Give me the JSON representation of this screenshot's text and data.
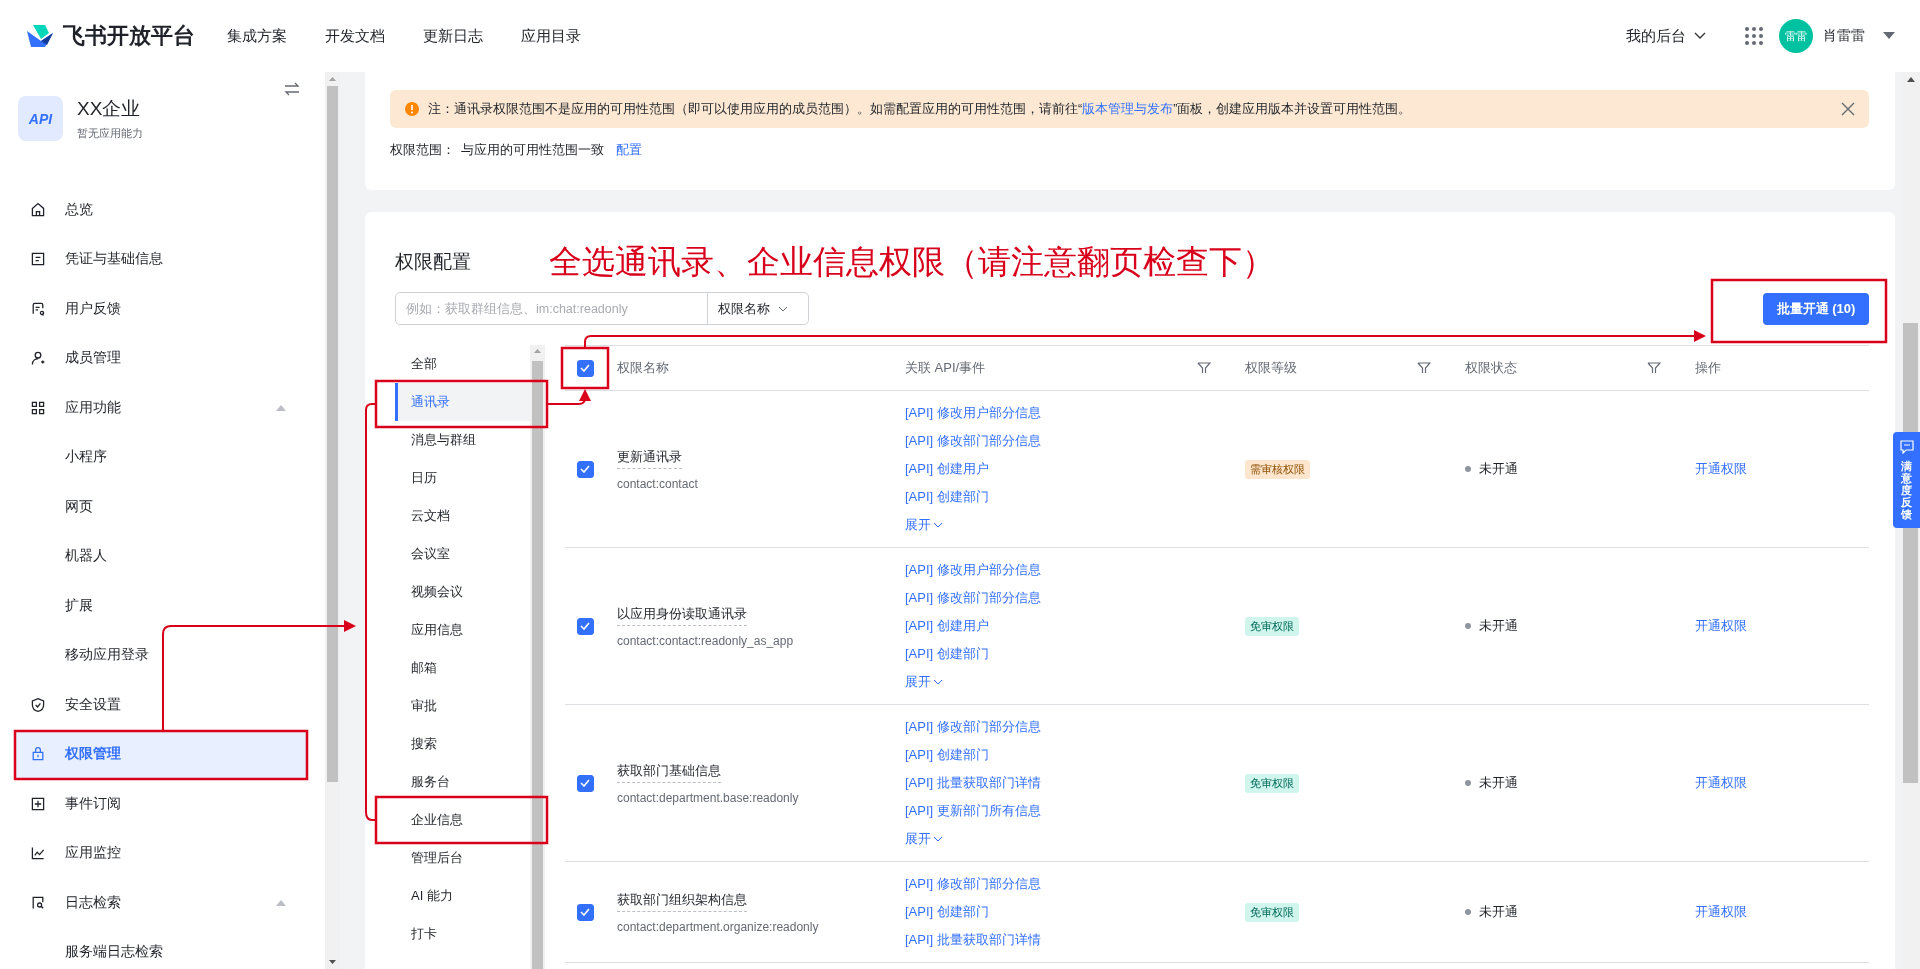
{
  "header": {
    "brand": "飞书开放平台",
    "nav": [
      "集成方案",
      "开发文档",
      "更新日志",
      "应用目录"
    ],
    "console": "我的后台",
    "avatar": "雷雷",
    "user": "肖雷雷"
  },
  "app": {
    "name": "XX企业",
    "logo": "API",
    "subtitle": "暂无应用能力"
  },
  "sidebar": {
    "items": [
      {
        "label": "总览",
        "selected": false
      },
      {
        "label": "凭证与基础信息",
        "selected": false
      },
      {
        "label": "用户反馈",
        "selected": false
      },
      {
        "label": "成员管理",
        "selected": false
      },
      {
        "label": "应用功能",
        "selected": false,
        "expanded": true,
        "children": [
          {
            "label": "小程序",
            "selected": false
          },
          {
            "label": "网页",
            "selected": false
          },
          {
            "label": "机器人",
            "selected": false
          },
          {
            "label": "扩展",
            "selected": false
          },
          {
            "label": "移动应用登录",
            "selected": false
          }
        ]
      },
      {
        "label": "安全设置",
        "selected": false
      },
      {
        "label": "权限管理",
        "selected": true
      },
      {
        "label": "事件订阅",
        "selected": false
      },
      {
        "label": "应用监控",
        "selected": false
      },
      {
        "label": "日志检索",
        "selected": false,
        "expanded": true,
        "children": [
          {
            "label": "服务端日志检索",
            "selected": false
          }
        ]
      }
    ]
  },
  "notice": {
    "before": "注：通讯录权限范围不是应用的可用性范围（即可以使用应用的成员范围）。如需配置应用的可用性范围，请前往“",
    "link": "版本管理与发布",
    "after": "”面板，创建应用版本并设置可用性范围。"
  },
  "scope": {
    "label": "权限范围：",
    "value": "与应用的可用性范围一致",
    "link": "配置"
  },
  "config": {
    "title": "权限配置",
    "annotation": "全选通讯录、企业信息权限（请注意翻页检查下）",
    "search_placeholder": "例如：获取群组信息、im:chat:readonly",
    "search_type": "权限名称",
    "batch_button": "批量开通 (10)"
  },
  "categories": [
    {
      "label": "全部",
      "selected": false
    },
    {
      "label": "通讯录",
      "selected": true
    },
    {
      "label": "消息与群组",
      "selected": false
    },
    {
      "label": "日历",
      "selected": false
    },
    {
      "label": "云文档",
      "selected": false
    },
    {
      "label": "会议室",
      "selected": false
    },
    {
      "label": "视频会议",
      "selected": false
    },
    {
      "label": "应用信息",
      "selected": false
    },
    {
      "label": "邮箱",
      "selected": false
    },
    {
      "label": "审批",
      "selected": false
    },
    {
      "label": "搜索",
      "selected": false
    },
    {
      "label": "服务台",
      "selected": false
    },
    {
      "label": "企业信息",
      "selected": false
    },
    {
      "label": "管理后台",
      "selected": false
    },
    {
      "label": "AI 能力",
      "selected": false
    },
    {
      "label": "打卡",
      "selected": false
    }
  ],
  "table": {
    "all_checked": true,
    "columns": [
      "权限名称",
      "关联 API/事件",
      "权限等级",
      "权限状态",
      "操作"
    ],
    "rows": [
      {
        "checked": true,
        "name": "更新通讯录",
        "scope": "contact:contact",
        "apis": [
          "[API] 修改用户部分信息",
          "[API] 修改部门部分信息",
          "[API] 创建用户",
          "[API] 创建部门"
        ],
        "expand": "展开",
        "permission_level": {
          "text": "需审核权限",
          "kind": "review"
        },
        "status": "未开通",
        "action": "开通权限"
      },
      {
        "checked": true,
        "name": "以应用身份读取通讯录",
        "scope": "contact:contact:readonly_as_app",
        "apis": [
          "[API] 修改用户部分信息",
          "[API] 修改部门部分信息",
          "[API] 创建用户",
          "[API] 创建部门"
        ],
        "expand": "展开",
        "permission_level": {
          "text": "免审权限",
          "kind": "free"
        },
        "status": "未开通",
        "action": "开通权限"
      },
      {
        "checked": true,
        "name": "获取部门基础信息",
        "scope": "contact:department.base:readonly",
        "apis": [
          "[API] 修改部门部分信息",
          "[API] 创建部门",
          "[API] 批量获取部门详情",
          "[API] 更新部门所有信息"
        ],
        "expand": "展开",
        "permission_level": {
          "text": "免审权限",
          "kind": "free"
        },
        "status": "未开通",
        "action": "开通权限"
      },
      {
        "checked": true,
        "name": "获取部门组织架构信息",
        "scope": "contact:department.organize:readonly",
        "apis": [
          "[API] 修改部门部分信息",
          "[API] 创建部门",
          "[API] 批量获取部门详情"
        ],
        "permission_level": {
          "text": "免审权限",
          "kind": "free"
        },
        "status": "未开通",
        "action": "开通权限"
      }
    ]
  },
  "feedback_tab": "满意度反馈"
}
